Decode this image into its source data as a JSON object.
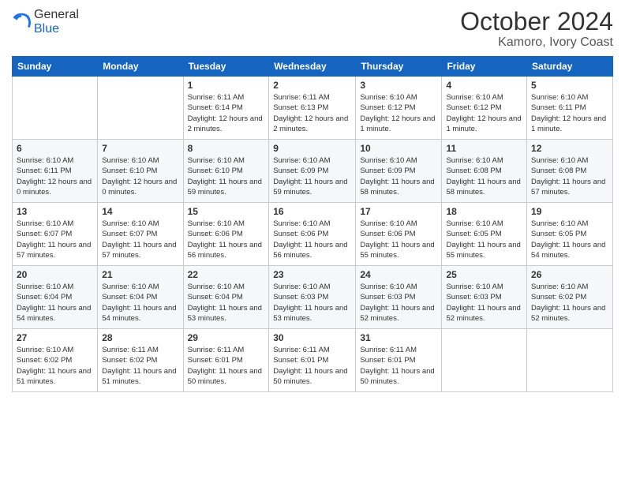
{
  "logo": {
    "general": "General",
    "blue": "Blue"
  },
  "header": {
    "month": "October 2024",
    "location": "Kamoro, Ivory Coast"
  },
  "weekdays": [
    "Sunday",
    "Monday",
    "Tuesday",
    "Wednesday",
    "Thursday",
    "Friday",
    "Saturday"
  ],
  "weeks": [
    [
      {
        "day": "",
        "sunrise": "",
        "sunset": "",
        "daylight": ""
      },
      {
        "day": "",
        "sunrise": "",
        "sunset": "",
        "daylight": ""
      },
      {
        "day": "1",
        "sunrise": "Sunrise: 6:11 AM",
        "sunset": "Sunset: 6:14 PM",
        "daylight": "Daylight: 12 hours and 2 minutes."
      },
      {
        "day": "2",
        "sunrise": "Sunrise: 6:11 AM",
        "sunset": "Sunset: 6:13 PM",
        "daylight": "Daylight: 12 hours and 2 minutes."
      },
      {
        "day": "3",
        "sunrise": "Sunrise: 6:10 AM",
        "sunset": "Sunset: 6:12 PM",
        "daylight": "Daylight: 12 hours and 1 minute."
      },
      {
        "day": "4",
        "sunrise": "Sunrise: 6:10 AM",
        "sunset": "Sunset: 6:12 PM",
        "daylight": "Daylight: 12 hours and 1 minute."
      },
      {
        "day": "5",
        "sunrise": "Sunrise: 6:10 AM",
        "sunset": "Sunset: 6:11 PM",
        "daylight": "Daylight: 12 hours and 1 minute."
      }
    ],
    [
      {
        "day": "6",
        "sunrise": "Sunrise: 6:10 AM",
        "sunset": "Sunset: 6:11 PM",
        "daylight": "Daylight: 12 hours and 0 minutes."
      },
      {
        "day": "7",
        "sunrise": "Sunrise: 6:10 AM",
        "sunset": "Sunset: 6:10 PM",
        "daylight": "Daylight: 12 hours and 0 minutes."
      },
      {
        "day": "8",
        "sunrise": "Sunrise: 6:10 AM",
        "sunset": "Sunset: 6:10 PM",
        "daylight": "Daylight: 11 hours and 59 minutes."
      },
      {
        "day": "9",
        "sunrise": "Sunrise: 6:10 AM",
        "sunset": "Sunset: 6:09 PM",
        "daylight": "Daylight: 11 hours and 59 minutes."
      },
      {
        "day": "10",
        "sunrise": "Sunrise: 6:10 AM",
        "sunset": "Sunset: 6:09 PM",
        "daylight": "Daylight: 11 hours and 58 minutes."
      },
      {
        "day": "11",
        "sunrise": "Sunrise: 6:10 AM",
        "sunset": "Sunset: 6:08 PM",
        "daylight": "Daylight: 11 hours and 58 minutes."
      },
      {
        "day": "12",
        "sunrise": "Sunrise: 6:10 AM",
        "sunset": "Sunset: 6:08 PM",
        "daylight": "Daylight: 11 hours and 57 minutes."
      }
    ],
    [
      {
        "day": "13",
        "sunrise": "Sunrise: 6:10 AM",
        "sunset": "Sunset: 6:07 PM",
        "daylight": "Daylight: 11 hours and 57 minutes."
      },
      {
        "day": "14",
        "sunrise": "Sunrise: 6:10 AM",
        "sunset": "Sunset: 6:07 PM",
        "daylight": "Daylight: 11 hours and 57 minutes."
      },
      {
        "day": "15",
        "sunrise": "Sunrise: 6:10 AM",
        "sunset": "Sunset: 6:06 PM",
        "daylight": "Daylight: 11 hours and 56 minutes."
      },
      {
        "day": "16",
        "sunrise": "Sunrise: 6:10 AM",
        "sunset": "Sunset: 6:06 PM",
        "daylight": "Daylight: 11 hours and 56 minutes."
      },
      {
        "day": "17",
        "sunrise": "Sunrise: 6:10 AM",
        "sunset": "Sunset: 6:06 PM",
        "daylight": "Daylight: 11 hours and 55 minutes."
      },
      {
        "day": "18",
        "sunrise": "Sunrise: 6:10 AM",
        "sunset": "Sunset: 6:05 PM",
        "daylight": "Daylight: 11 hours and 55 minutes."
      },
      {
        "day": "19",
        "sunrise": "Sunrise: 6:10 AM",
        "sunset": "Sunset: 6:05 PM",
        "daylight": "Daylight: 11 hours and 54 minutes."
      }
    ],
    [
      {
        "day": "20",
        "sunrise": "Sunrise: 6:10 AM",
        "sunset": "Sunset: 6:04 PM",
        "daylight": "Daylight: 11 hours and 54 minutes."
      },
      {
        "day": "21",
        "sunrise": "Sunrise: 6:10 AM",
        "sunset": "Sunset: 6:04 PM",
        "daylight": "Daylight: 11 hours and 54 minutes."
      },
      {
        "day": "22",
        "sunrise": "Sunrise: 6:10 AM",
        "sunset": "Sunset: 6:04 PM",
        "daylight": "Daylight: 11 hours and 53 minutes."
      },
      {
        "day": "23",
        "sunrise": "Sunrise: 6:10 AM",
        "sunset": "Sunset: 6:03 PM",
        "daylight": "Daylight: 11 hours and 53 minutes."
      },
      {
        "day": "24",
        "sunrise": "Sunrise: 6:10 AM",
        "sunset": "Sunset: 6:03 PM",
        "daylight": "Daylight: 11 hours and 52 minutes."
      },
      {
        "day": "25",
        "sunrise": "Sunrise: 6:10 AM",
        "sunset": "Sunset: 6:03 PM",
        "daylight": "Daylight: 11 hours and 52 minutes."
      },
      {
        "day": "26",
        "sunrise": "Sunrise: 6:10 AM",
        "sunset": "Sunset: 6:02 PM",
        "daylight": "Daylight: 11 hours and 52 minutes."
      }
    ],
    [
      {
        "day": "27",
        "sunrise": "Sunrise: 6:10 AM",
        "sunset": "Sunset: 6:02 PM",
        "daylight": "Daylight: 11 hours and 51 minutes."
      },
      {
        "day": "28",
        "sunrise": "Sunrise: 6:11 AM",
        "sunset": "Sunset: 6:02 PM",
        "daylight": "Daylight: 11 hours and 51 minutes."
      },
      {
        "day": "29",
        "sunrise": "Sunrise: 6:11 AM",
        "sunset": "Sunset: 6:01 PM",
        "daylight": "Daylight: 11 hours and 50 minutes."
      },
      {
        "day": "30",
        "sunrise": "Sunrise: 6:11 AM",
        "sunset": "Sunset: 6:01 PM",
        "daylight": "Daylight: 11 hours and 50 minutes."
      },
      {
        "day": "31",
        "sunrise": "Sunrise: 6:11 AM",
        "sunset": "Sunset: 6:01 PM",
        "daylight": "Daylight: 11 hours and 50 minutes."
      },
      {
        "day": "",
        "sunrise": "",
        "sunset": "",
        "daylight": ""
      },
      {
        "day": "",
        "sunrise": "",
        "sunset": "",
        "daylight": ""
      }
    ]
  ]
}
